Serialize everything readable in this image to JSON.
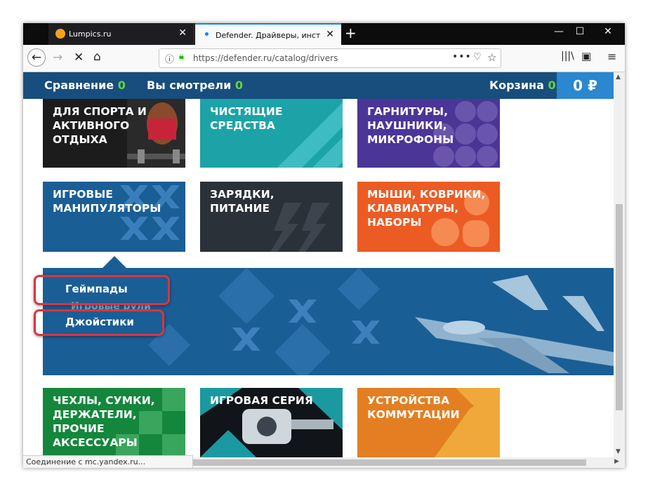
{
  "browser": {
    "tabs": [
      {
        "title": "Lumpics.ru",
        "active": false
      },
      {
        "title": "Defender. Драйверы, инструк",
        "active": true
      }
    ],
    "url": "https://defender.ru/catalog/drivers",
    "status_text": "Соединение с mc.yandex.ru..."
  },
  "site": {
    "compare_label": "Сравнение",
    "compare_count": "0",
    "viewed_label": "Вы смотрели",
    "viewed_count": "0",
    "cart_label": "Корзина",
    "cart_count": "0",
    "cart_total": "0 ₽"
  },
  "tiles": [
    {
      "label": "ДЛЯ СПОРТА И АКТИВНОГО ОТДЫХА",
      "color": "#1c1c1c"
    },
    {
      "label": "ЧИСТЯЩИЕ СРЕДСТВА",
      "color": "#1ca3a8"
    },
    {
      "label": "ГАРНИТУРЫ, НАУШНИКИ, МИКРОФОНЫ",
      "color": "#4b3596"
    },
    {
      "label": "ИГРОВЫЕ МАНИПУЛЯТОРЫ",
      "color": "#1a5e96"
    },
    {
      "label": "ЗАРЯДКИ, ПИТАНИЕ",
      "color": "#2a3138"
    },
    {
      "label": "МЫШИ, КОВРИКИ, КЛАВИАТУРЫ, НАБОРЫ",
      "color": "#ec5b24"
    },
    {
      "label": "ЧЕХЛЫ, СУМКИ, ДЕРЖАТЕЛИ, ПРОЧИЕ АКСЕССУАРЫ",
      "color": "#14873c"
    },
    {
      "label": "ИГРОВАЯ СЕРИЯ",
      "color": "#111418"
    },
    {
      "label": "УСТРОЙСТВА КОММУТАЦИИ",
      "color": "#e37f22"
    }
  ],
  "submenu": {
    "items": [
      "Геймпады",
      "Джойстики"
    ],
    "partial_item": "Игровые рули"
  }
}
